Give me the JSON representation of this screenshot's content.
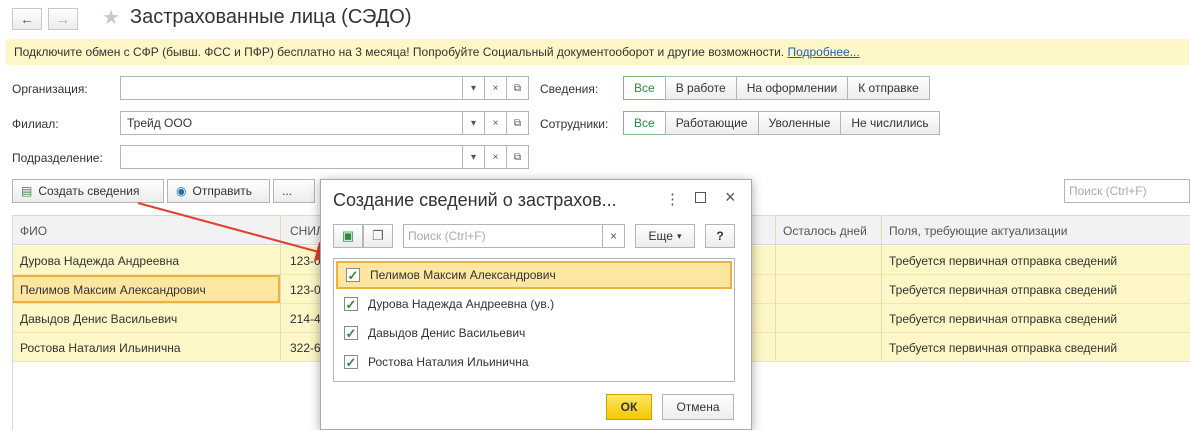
{
  "window": {
    "title": "Застрахованные лица (СЭДО)",
    "back": "←",
    "forward": "→",
    "favorite": "★"
  },
  "banner": {
    "text": "Подключите обмен с СФР (бывш. ФСС и ПФР) бесплатно на 3 месяца! Попробуйте Социальный документооборот и другие возможности.",
    "link": "Подробнее..."
  },
  "filters": {
    "organization_label": "Организация:",
    "organization_value": "",
    "branch_label": "Филиал:",
    "branch_value": "Трейд ООО",
    "division_label": "Подразделение:",
    "division_value": "",
    "info_label": "Сведения:",
    "info_options": [
      "Все",
      "В работе",
      "На оформлении",
      "К отправке"
    ],
    "employees_label": "Сотрудники:",
    "employees_options": [
      "Все",
      "Работающие",
      "Уволенные",
      "Не числились"
    ]
  },
  "toolbar": {
    "create_label": "Создать сведения",
    "send_label": "Отправить",
    "more_label": "...",
    "search_placeholder": "Поиск (Ctrl+F)"
  },
  "table": {
    "columns": [
      "ФИО",
      "СНИЛ",
      "Осталось дней",
      "Поля, требующие актуализации"
    ],
    "rows": [
      {
        "name": "Дурова Надежда Андреевна",
        "snils": "123-0",
        "days": "",
        "fields": "Требуется первичная отправка сведений"
      },
      {
        "name": "Пелимов Максим Александрович",
        "snils": "123-0",
        "days": "",
        "fields": "Требуется первичная отправка сведений"
      },
      {
        "name": "Давыдов Денис Васильевич",
        "snils": "214-4",
        "days": "",
        "fields": "Требуется первичная отправка сведений"
      },
      {
        "name": "Ростова Наталия Ильинична",
        "snils": "322-6",
        "days": "",
        "fields": "Требуется первичная отправка сведений"
      }
    ]
  },
  "dialog": {
    "title": "Создание сведений о застрахов...",
    "search_placeholder": "Поиск (Ctrl+F)",
    "more_label": "Еще",
    "help_label": "?",
    "items": [
      {
        "name": "Пелимов Максим Александрович",
        "checked": true
      },
      {
        "name": "Дурова Надежда Андреевна (ув.)",
        "checked": true
      },
      {
        "name": "Давыдов Денис Васильевич",
        "checked": true
      },
      {
        "name": "Ростова Наталия Ильинична",
        "checked": true
      }
    ],
    "ok_label": "ОК",
    "cancel_label": "Отмена"
  },
  "colors": {
    "highlight": "#fdf6c6",
    "selection": "#fde6a0",
    "accent_green": "#2e8b3a",
    "ok_yellow": "#f5c800",
    "arrow_red": "#e04030"
  }
}
